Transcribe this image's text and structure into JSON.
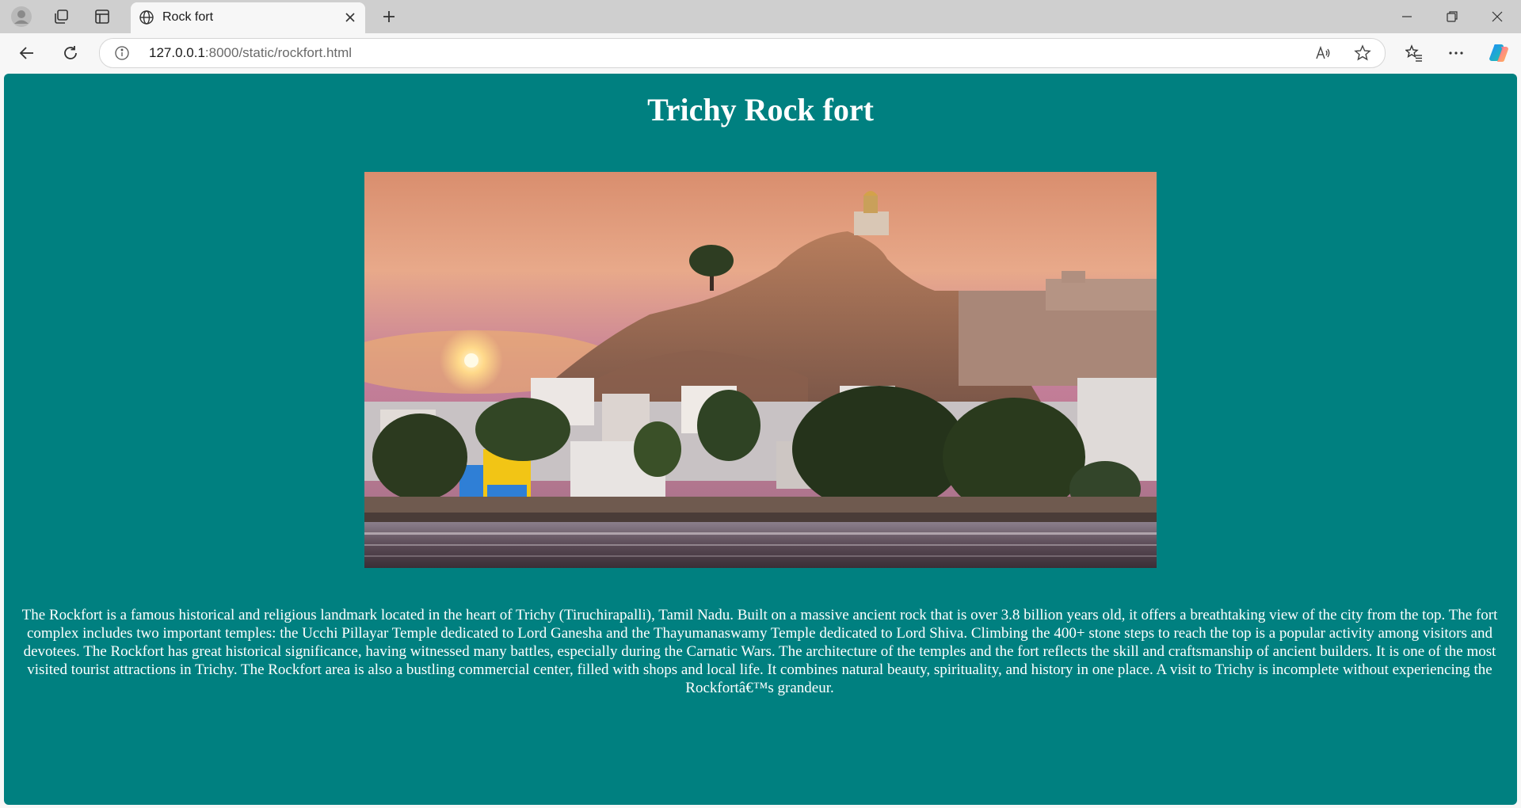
{
  "browser": {
    "tab_title": "Rock fort",
    "url_host": "127.0.0.1",
    "url_rest": ":8000/static/rockfort.html",
    "profile_icon": "profile-avatar-icon",
    "workspaces_icon": "workspaces-icon",
    "tab_actions_icon": "tab-actions-icon",
    "tab_favicon": "globe-icon",
    "read_aloud_icon": "read-aloud-icon",
    "favorite_icon": "star-icon",
    "favorites_icon": "favorites-icon",
    "menu_icon": "more-icon",
    "copilot_icon": "copilot-icon"
  },
  "page": {
    "background": "#008080",
    "title": "Trichy Rock fort",
    "description": "The Rockfort is a famous historical and religious landmark located in the heart of Trichy (Tiruchirapalli), Tamil Nadu. Built on a massive ancient rock that is over 3.8 billion years old, it offers a breathtaking view of the city from the top. The fort complex includes two important temples: the Ucchi Pillayar Temple dedicated to Lord Ganesha and the Thayumanaswamy Temple dedicated to Lord Shiva. Climbing the 400+ stone steps to reach the top is a popular activity among visitors and devotees. The Rockfort has great historical significance, having witnessed many battles, especially during the Carnatic Wars. The architecture of the temples and the fort reflects the skill and craftsmanship of ancient builders. It is one of the most visited tourist attractions in Trichy. The Rockfort area is also a bustling commercial center, filled with shops and local life. It combines natural beauty, spirituality, and history in one place. A visit to Trichy is incomplete without experiencing the Rockfortâ€™s grandeur."
  }
}
